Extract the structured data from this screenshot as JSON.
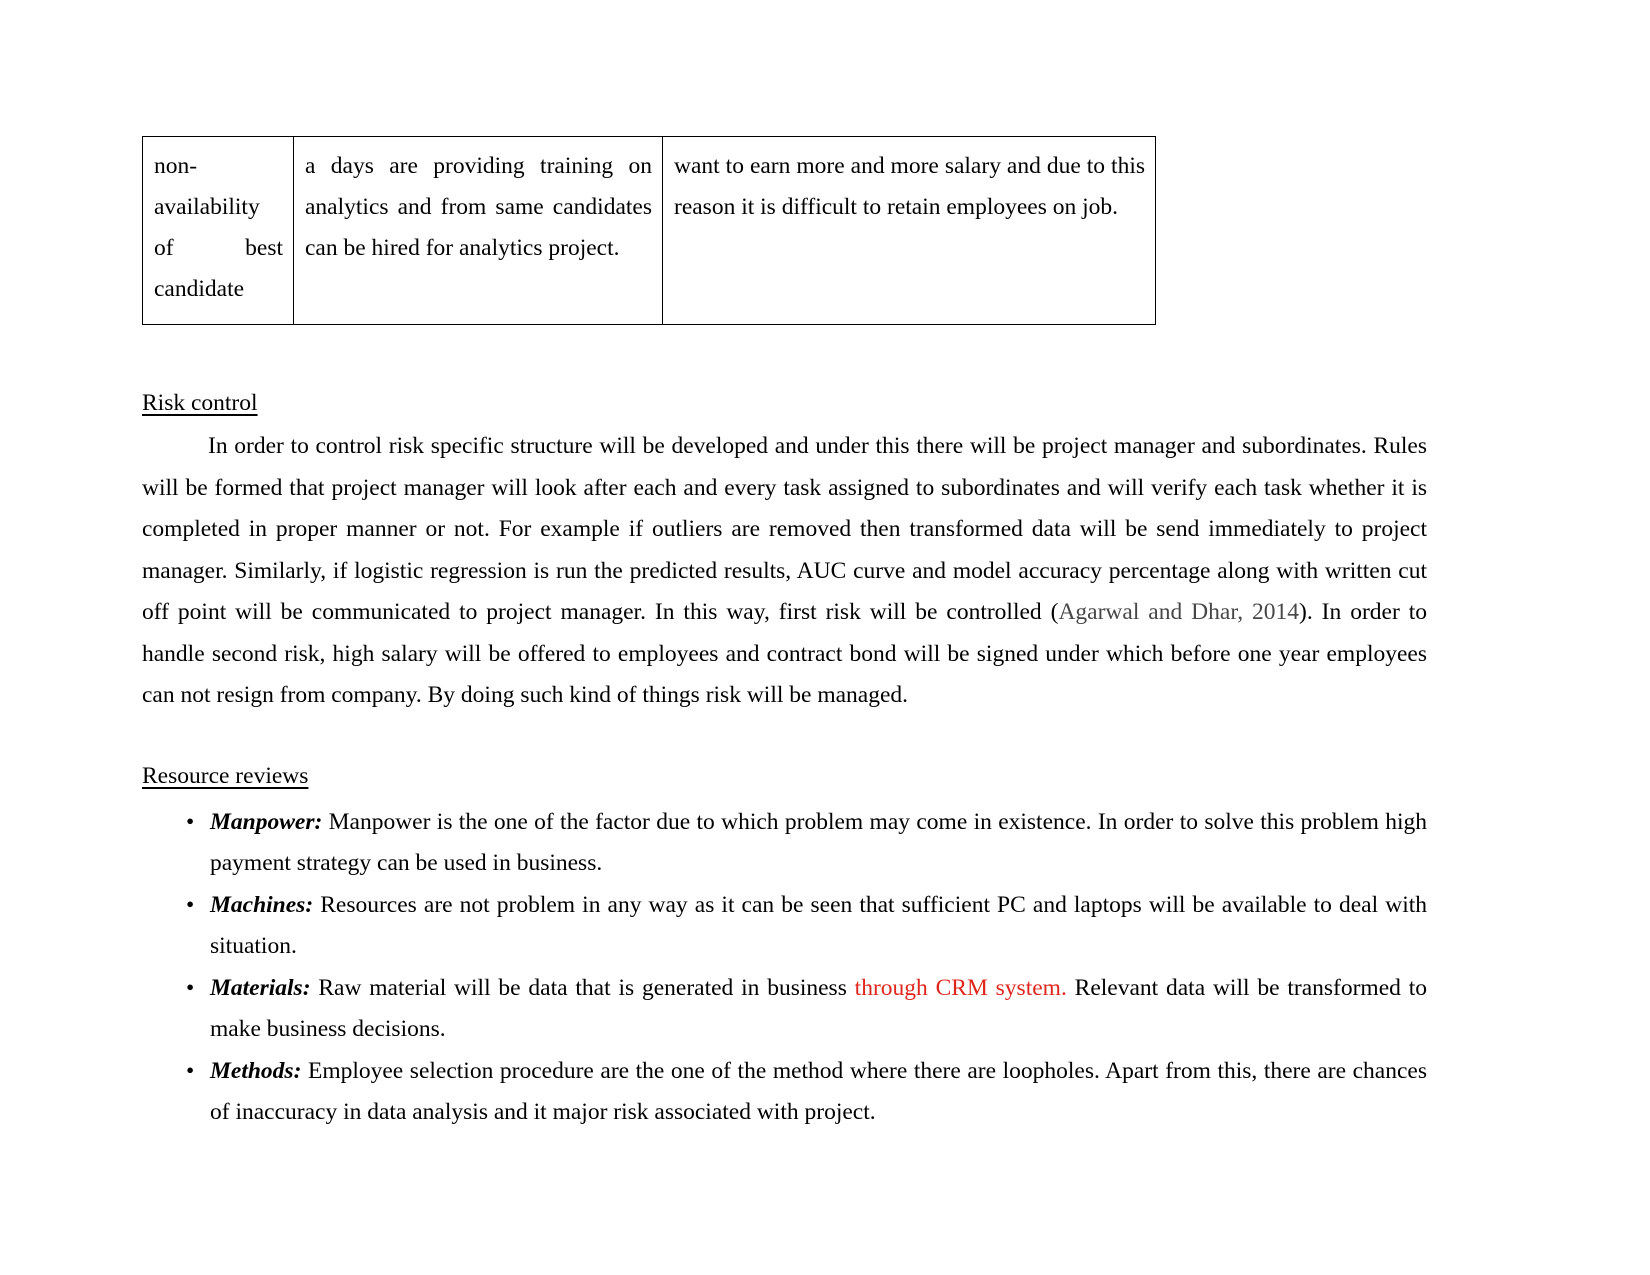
{
  "document": {
    "bullet_glyph": "•",
    "colors": {
      "text": "#000000",
      "citation": "#474747",
      "highlight_red": "#e0261c",
      "table_border": "#000000",
      "page_background": "#ffffff"
    }
  },
  "table": {
    "rows": [
      {
        "col_a": "non-availability of best candidate",
        "col_b": "a days are providing training on analytics and from same candidates can be hired for analytics project.",
        "col_c": "want to earn more and more salary and due to this reason it is difficult to retain employees on job."
      }
    ]
  },
  "sections": [
    {
      "heading": "Risk control",
      "paragraph_part_1": "In order to control risk specific structure will be developed and under this there will be project manager and subordinates. Rules will be formed that project manager will look after each and every task assigned to subordinates and will verify each task whether it is completed in proper manner or not. For example if outliers are removed then transformed data will be send immediately to project manager. Similarly, if logistic regression is run the predicted results, AUC curve and model accuracy percentage along with written cut off point will be communicated to project manager. In this way, first risk will be controlled (",
      "citation": "Agarwal and Dhar, 2014",
      "paragraph_part_2": "). In order to handle second risk, high salary will be offered to employees and contract bond will be signed under which before one year employees can not resign from company. By doing such kind of things risk will be managed."
    },
    {
      "heading": "Resource reviews"
    }
  ],
  "resource_reviews": {
    "items": [
      {
        "term": "Manpower:",
        "text_before": " Manpower is the one of the factor due to which problem may come in existence. In order to solve this problem high payment strategy can be used in business.",
        "highlight": "",
        "text_after": ""
      },
      {
        "term": "Machines:",
        "text_before": " Resources are not problem in any way as it can be seen that sufficient PC and laptops will be available to deal with situation.",
        "highlight": "",
        "text_after": ""
      },
      {
        "term": "Materials:",
        "text_before": " Raw material will be data that is generated in business ",
        "highlight": "through CRM system.",
        "text_after": " Relevant data will be transformed to make business decisions."
      },
      {
        "term": "Methods:",
        "text_before": " Employee selection procedure are the one of the method where there are loopholes. Apart from this, there are chances of inaccuracy in data analysis and it major risk associated with project.",
        "highlight": "",
        "text_after": ""
      }
    ]
  }
}
